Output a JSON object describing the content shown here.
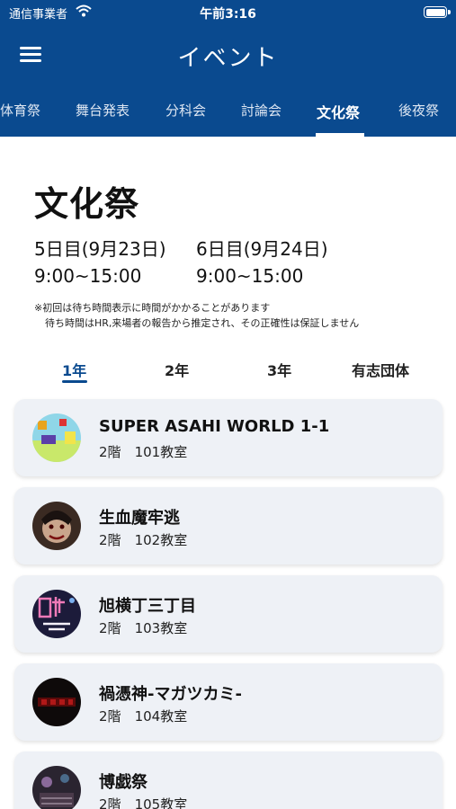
{
  "status_bar": {
    "carrier": "通信事業者",
    "time": "午前3:16"
  },
  "header": {
    "title": "イベント"
  },
  "nav_tabs": [
    "体育祭",
    "舞台発表",
    "分科会",
    "討論会",
    "文化祭",
    "後夜祭"
  ],
  "active_tab": "文化祭",
  "page": {
    "title": "文化祭",
    "days": [
      {
        "label": "5日目(9月23日)",
        "hours": "9:00~15:00"
      },
      {
        "label": "6日目(9月24日)",
        "hours": "9:00~15:00"
      }
    ],
    "notes": [
      "※初回は待ち時間表示に時間がかかることがあります",
      "待ち時間はHR,来場者の報告から推定され、その正確性は保証しません"
    ]
  },
  "grade_tabs": [
    "1年",
    "2年",
    "3年",
    "有志団体"
  ],
  "active_grade": "1年",
  "events": [
    {
      "name": "SUPER ASAHI WORLD 1-1",
      "floor": "2階",
      "room": "101教室"
    },
    {
      "name": "生血魔牢逃",
      "floor": "2階",
      "room": "102教室"
    },
    {
      "name": "旭横丁三丁目",
      "floor": "2階",
      "room": "103教室"
    },
    {
      "name": "禍憑神-マガツカミ-",
      "floor": "2階",
      "room": "104教室"
    },
    {
      "name": "博戯祭",
      "floor": "2階",
      "room": "105教室"
    }
  ],
  "colors": {
    "header_bg": "#0a4a8f",
    "card_bg": "#eef1f6",
    "accent": "#0a4a8f"
  }
}
